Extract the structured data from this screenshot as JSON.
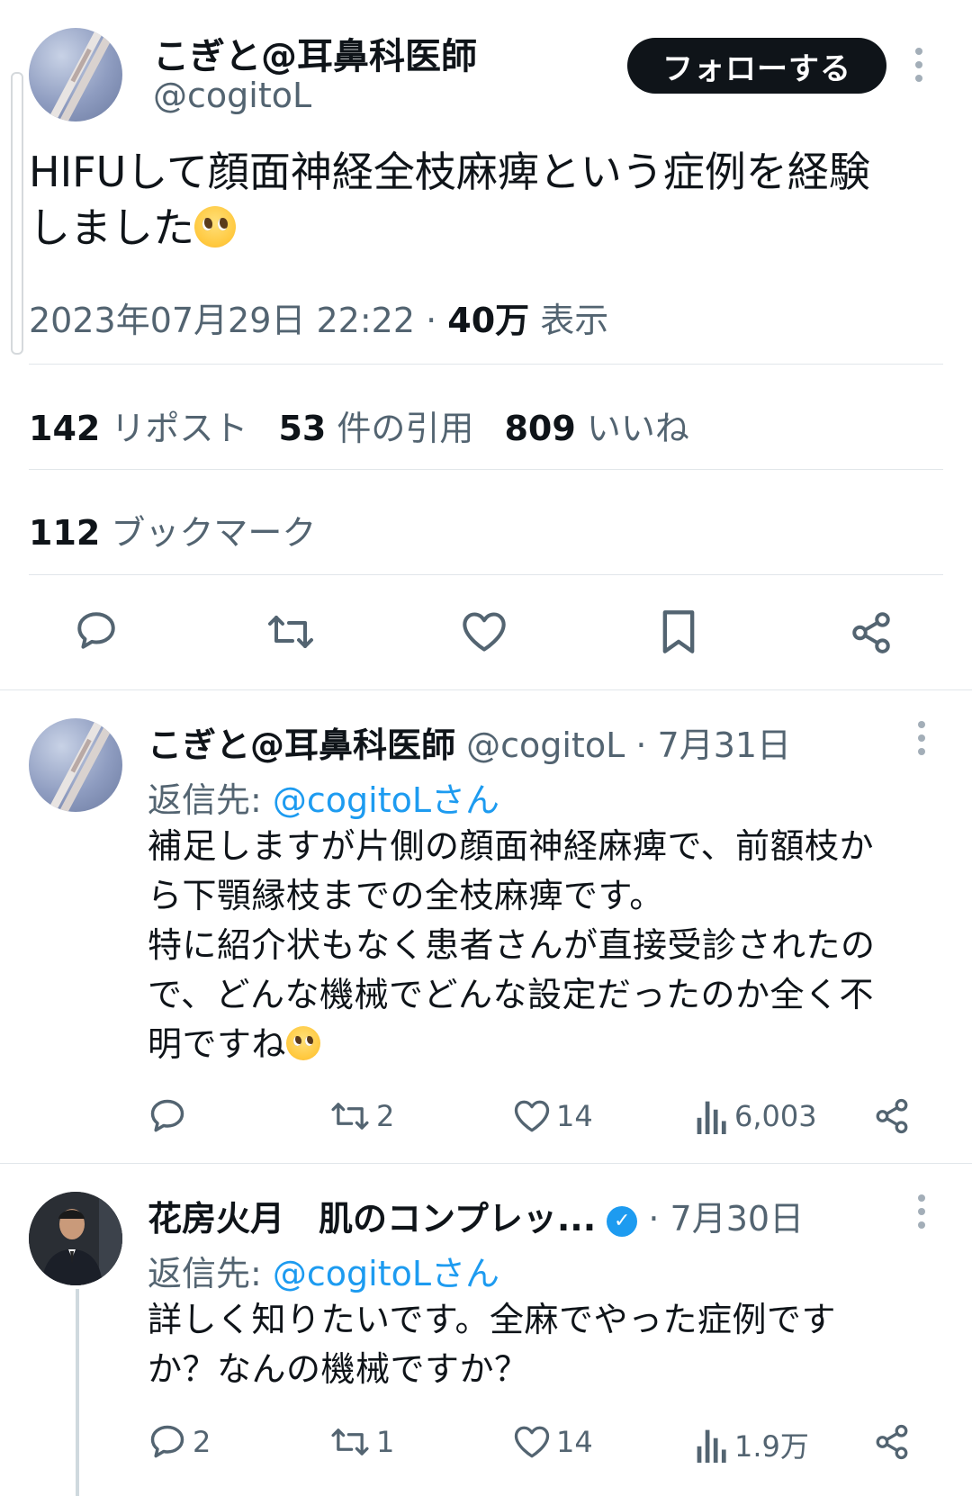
{
  "main_tweet": {
    "author_name": "こぎと@耳鼻科医師",
    "handle": "@cogitoL",
    "follow_label": "フォローする",
    "text_line1": "HIFUして顔面神経全枝麻痺という症例を経験",
    "text_line2": "しました",
    "emoji": "pleading-face",
    "timestamp": "2023年07月29日 22:22",
    "separator": "·",
    "views_count": "40万",
    "views_label": "表示",
    "reposts_count": "142",
    "reposts_label": "リポスト",
    "quotes_count": "53",
    "quotes_label": "件の引用",
    "likes_count": "809",
    "likes_label": "いいね",
    "bookmarks_count": "112",
    "bookmarks_label": "ブックマーク",
    "actions": [
      "reply-icon",
      "retweet-icon",
      "heart-icon",
      "bookmark-icon",
      "share-icon"
    ]
  },
  "replies": [
    {
      "author_name": "こぎと@耳鼻科医師",
      "handle": "@cogitoL",
      "separator": "·",
      "date": "7月31日",
      "reply_to_label": "返信先:",
      "reply_to_link": "@cogitoLさん",
      "lines": [
        "補足しますが片側の顔面神経麻痺で、前額枝か",
        "ら下顎縁枝までの全枝麻痺です。",
        "特に紹介状もなく患者さんが直接受診されたの",
        "で、どんな機械でどんな設定だったのか全く不",
        "明ですね"
      ],
      "reply_count": "",
      "retweet_count": "2",
      "like_count": "14",
      "view_count": "6,003"
    },
    {
      "author_name": "花房火月　肌のコンプレッ...",
      "verified": true,
      "separator": "·",
      "date": "7月30日",
      "reply_to_label": "返信先:",
      "reply_to_link": "@cogitoLさん",
      "lines": [
        "詳しく知りたいです。全麻でやった症例です",
        "か？なんの機械ですか？"
      ],
      "reply_count": "2",
      "retweet_count": "1",
      "like_count": "14",
      "view_count": "1.9万"
    }
  ],
  "colors": {
    "text": "#0f1419",
    "muted": "#536471",
    "link": "#1d9bf0",
    "divider": "#e1e6ea"
  }
}
